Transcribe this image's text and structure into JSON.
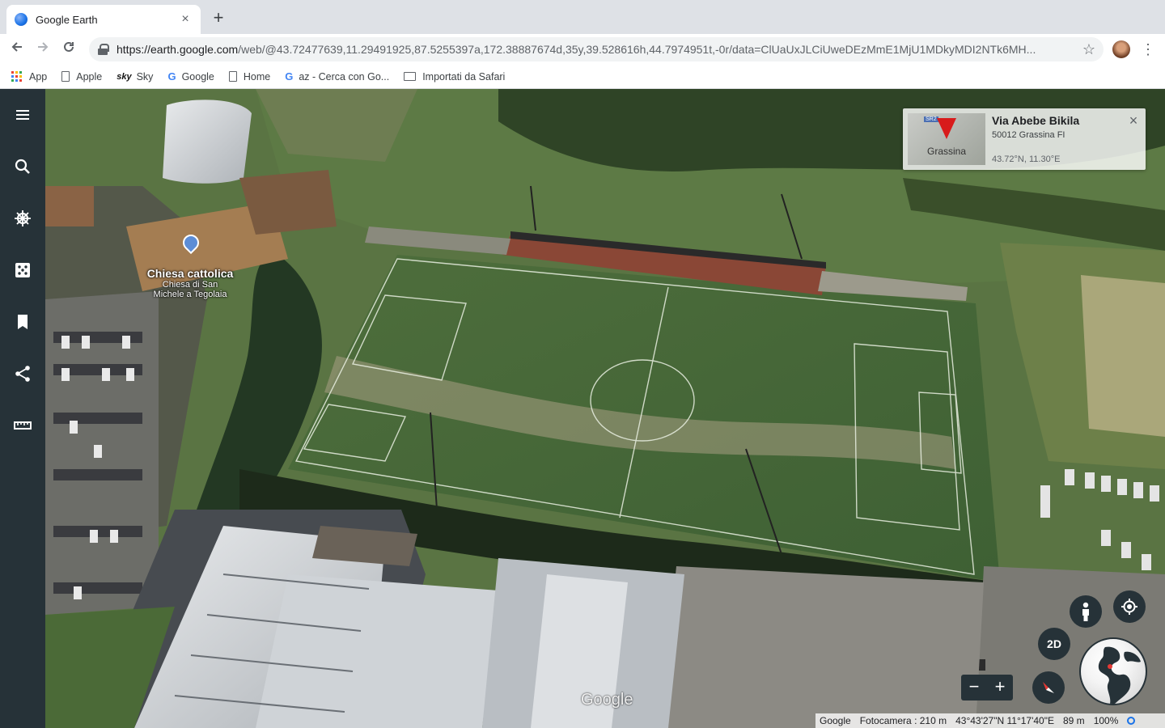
{
  "browser": {
    "tab_title": "Google Earth",
    "tab_close": "×",
    "new_tab": "+",
    "url_host": "https://earth.google.com",
    "url_path": "/web/@43.72477639,11.29491925,87.5255397a,172.38887674d,35y,39.528616h,44.7974951t,-0r/data=ClUaUxJLCiUweDEzMmE1MjU1MDkyMDI2NTk6MH...",
    "bookmarks": [
      {
        "label": "App",
        "icon": "apps-grid-icon"
      },
      {
        "label": "Apple",
        "icon": "document-icon"
      },
      {
        "label": "Sky",
        "icon": "sky-logo-icon"
      },
      {
        "label": "Google",
        "icon": "google-g-icon"
      },
      {
        "label": "Home",
        "icon": "document-icon"
      },
      {
        "label": "az - Cerca con Go...",
        "icon": "google-g-icon"
      },
      {
        "label": "Importati da Safari",
        "icon": "folder-icon"
      }
    ]
  },
  "sidebar": {
    "items": [
      {
        "name": "menu",
        "icon": "hamburger-menu-icon"
      },
      {
        "name": "search",
        "icon": "search-icon"
      },
      {
        "name": "voyager",
        "icon": "ship-wheel-icon"
      },
      {
        "name": "feeling-lucky",
        "icon": "dice-icon"
      },
      {
        "name": "projects",
        "icon": "bookmark-icon"
      },
      {
        "name": "share",
        "icon": "share-icon"
      },
      {
        "name": "measure",
        "icon": "ruler-icon"
      }
    ]
  },
  "map": {
    "poi": {
      "title": "Chiesa cattolica",
      "subtitle_line1": "Chiesa di San",
      "subtitle_line2": "Michele a Tegolaia"
    },
    "info_card": {
      "thumb_label": "Grassina",
      "thumb_badge": "SR2",
      "title": "Via Abebe Bikila",
      "address": "50012 Grassina FI",
      "coords": "43.72°N, 11.30°E",
      "close": "×"
    },
    "controls": {
      "mode_2d": "2D",
      "zoom_out": "−",
      "zoom_in": "+"
    },
    "watermark": "Google",
    "status": {
      "provider": "Google",
      "camera": "Fotocamera : 210 m",
      "coordinates": "43°43'27\"N 11°17'40\"E",
      "elevation": "89 m",
      "loading": "100%"
    }
  },
  "colors": {
    "sidebar_bg": "#263238",
    "pin_red": "#d81b1b",
    "accent_blue": "#1a73e8"
  }
}
